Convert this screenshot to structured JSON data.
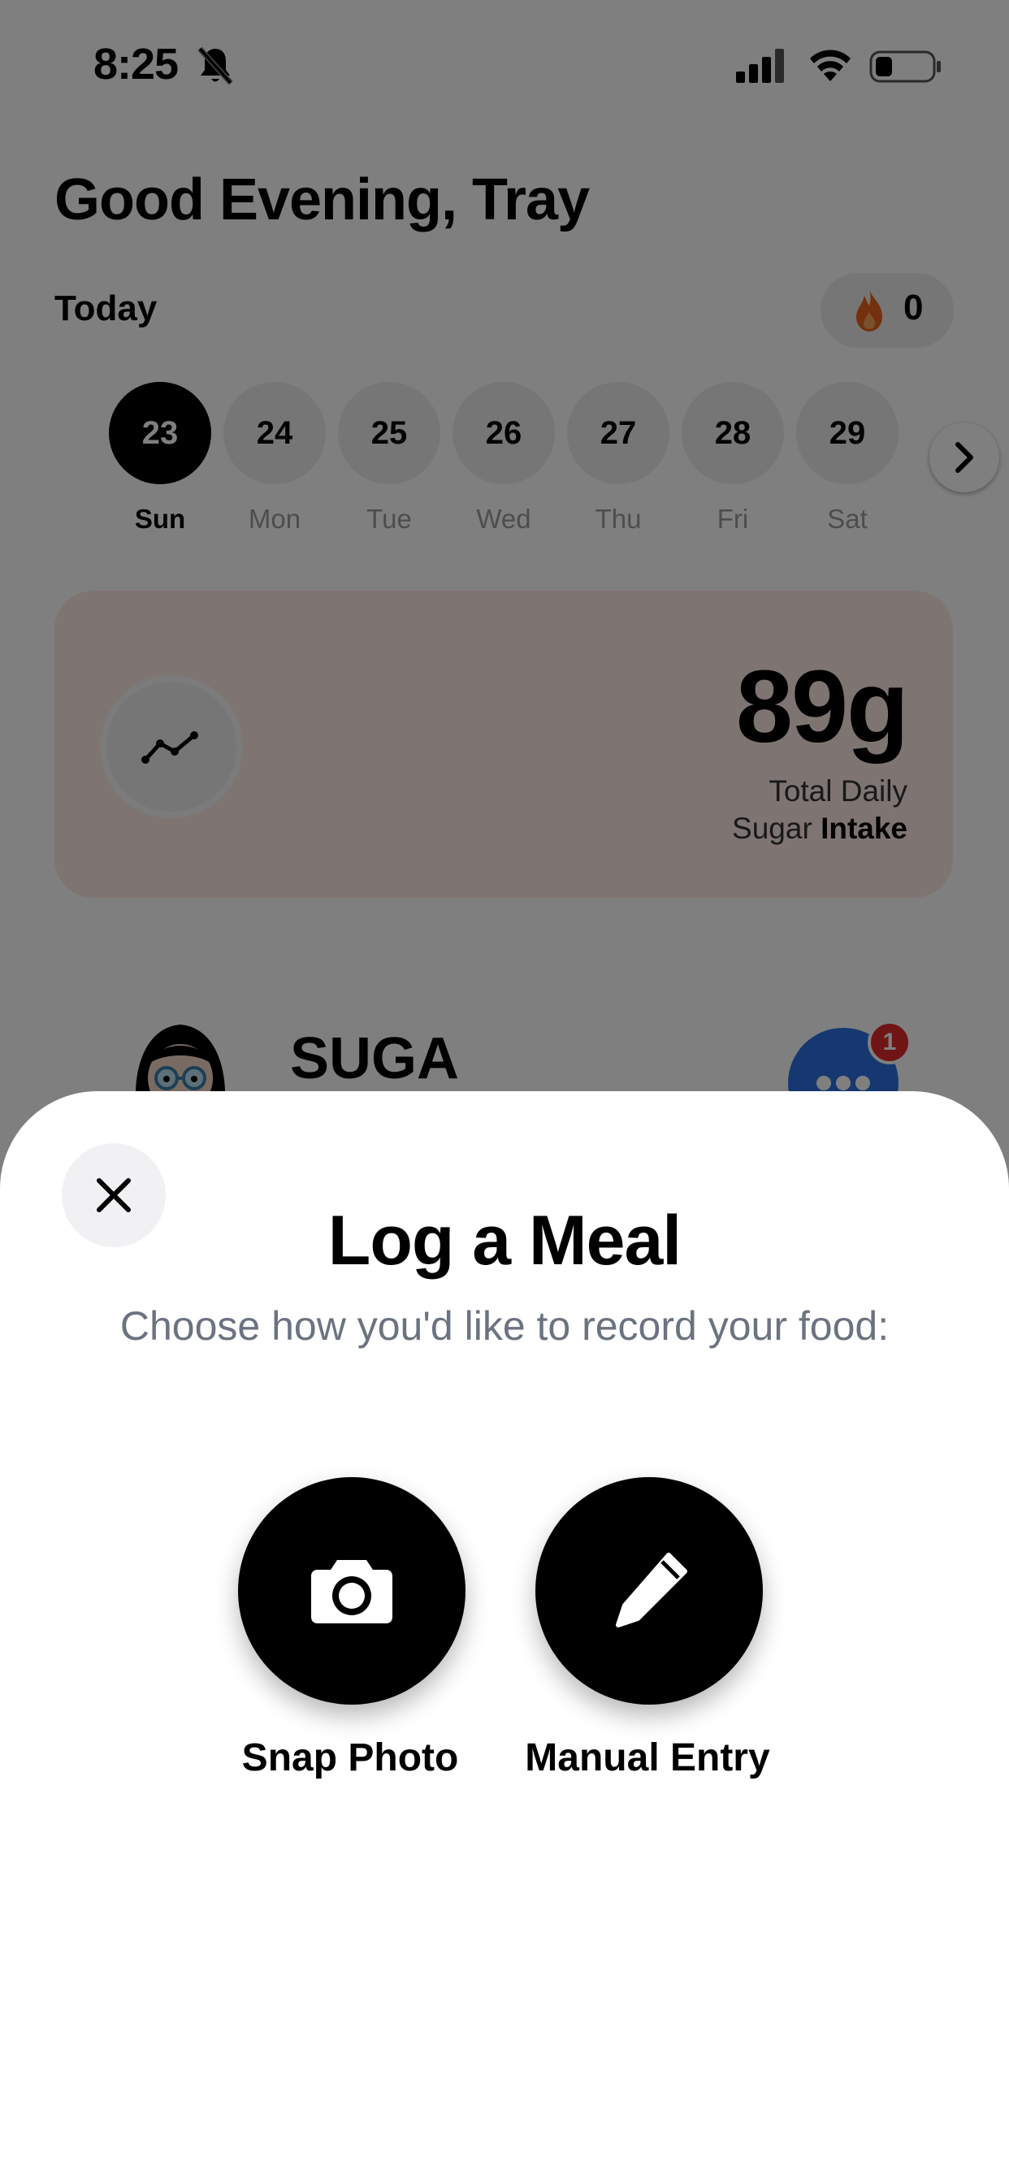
{
  "status_bar": {
    "time": "8:25"
  },
  "home": {
    "greeting": "Good Evening, Tray",
    "today_label": "Today",
    "streak_count": "0",
    "days": [
      {
        "num": "23",
        "name": "Sun",
        "active": true
      },
      {
        "num": "24",
        "name": "Mon",
        "active": false
      },
      {
        "num": "25",
        "name": "Tue",
        "active": false
      },
      {
        "num": "26",
        "name": "Wed",
        "active": false
      },
      {
        "num": "27",
        "name": "Thu",
        "active": false
      },
      {
        "num": "28",
        "name": "Fri",
        "active": false
      },
      {
        "num": "29",
        "name": "Sat",
        "active": false
      }
    ],
    "sugar_card": {
      "value": "89g",
      "label_line1": "Total Daily",
      "label_line2_prefix": "Sugar",
      "label_line2_bold": "Intake"
    },
    "assistant": {
      "name": "SUGA",
      "chat_badge": "1"
    }
  },
  "sheet": {
    "title": "Log a Meal",
    "subtitle": "Choose how you'd like to record your food:",
    "options": [
      {
        "label": "Snap Photo",
        "icon": "camera-icon"
      },
      {
        "label": "Manual Entry",
        "icon": "pencil-icon"
      }
    ]
  },
  "colors": {
    "overlay": "rgba(0,0,0,0.5)",
    "card_bg": "#fde8e3",
    "flame": "#e8621c",
    "chat_blue": "#2f6fe0",
    "badge_red": "#e02b2b",
    "subtitle_gray": "#6b7280"
  }
}
